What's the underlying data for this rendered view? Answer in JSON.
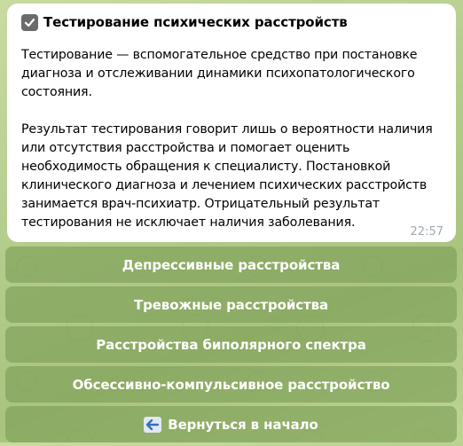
{
  "message": {
    "title": "Тестирование психических расстройств",
    "paragraph1": "Тестирование — вспомогательное средство при постановке диагноза и отслеживании динамики психопатологического состояния.",
    "paragraph2": "Результат тестирования говорит лишь о вероятности наличия или отсутствия расстройства и помогает оценить необходимость обращения к специалисту. Постановкой клинического диагноза и лечением психических расстройств занимается врач-психиатр. Отрицательный результат тестирования не исключает наличия заболевания.",
    "time": "22:57",
    "title_icon": "check-box-icon"
  },
  "keyboard": {
    "buttons": [
      {
        "label": "Депрессивные расстройства"
      },
      {
        "label": "Тревожные расстройства"
      },
      {
        "label": "Расстройства биполярного спектра"
      },
      {
        "label": "Обсессивно-компульсивное расстройство"
      },
      {
        "label": "Вернуться в начало",
        "icon": "back-arrow-icon"
      }
    ]
  },
  "colors": {
    "bubble": "#ffffff",
    "button_bg": "#7a9c54",
    "button_text": "#ffffff",
    "time_text": "#a0a8b0",
    "background": "#b3cd8c"
  }
}
